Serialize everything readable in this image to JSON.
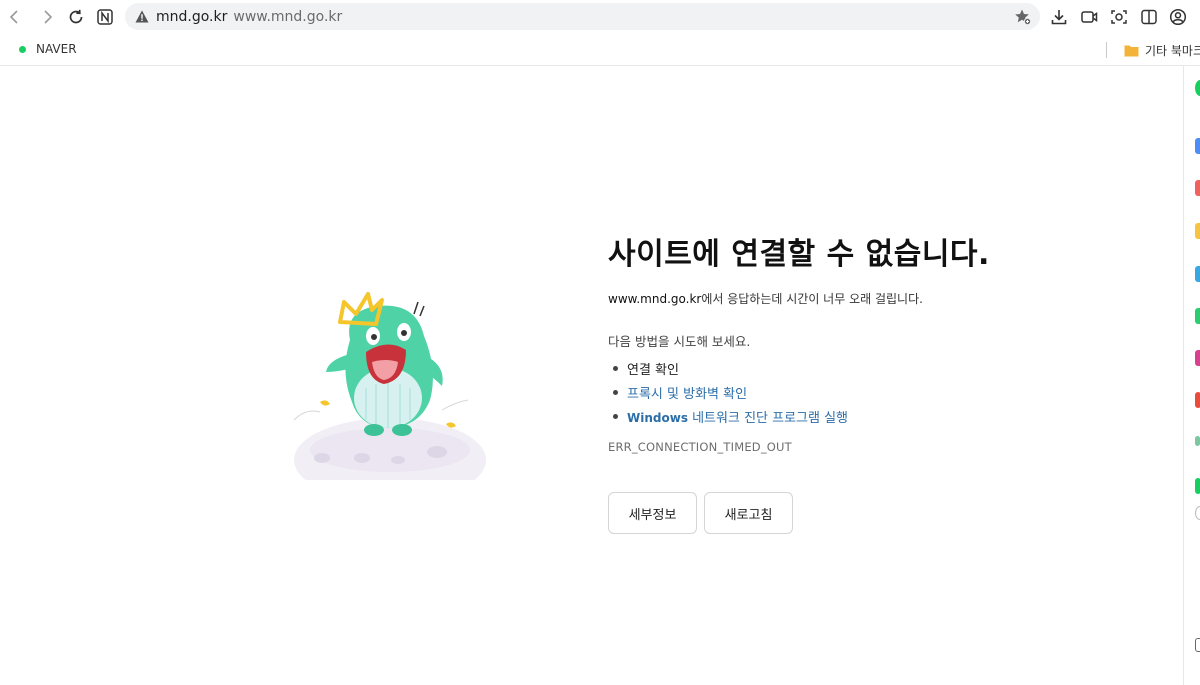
{
  "toolbar": {
    "address_domain": "mnd.go.kr",
    "address_url": "www.mnd.go.kr"
  },
  "bookmarks": {
    "items": [
      {
        "label": "NAVER",
        "icon": "naver-dot-icon",
        "color": "#19ce60"
      }
    ],
    "other_label": "기타 북마크"
  },
  "error_page": {
    "title": "사이트에 연결할 수 없습니다.",
    "description_host": "www.mnd.go.kr",
    "description_rest": "에서 응답하는데 시간이 너무 오래 걸립니다.",
    "try_text": "다음 방법을 시도해 보세요.",
    "suggestions": [
      {
        "text": "연결 확인"
      },
      {
        "text": "프록시 및 방화벽 확인"
      },
      {
        "prefix": "Windows",
        "text": " 네트워크 진단 프로그램 실행"
      }
    ],
    "error_code": "ERR_CONNECTION_TIMED_OUT",
    "buttons": {
      "details": "세부정보",
      "reload": "새로고침"
    }
  },
  "colors": {
    "link": "#2b6ea8",
    "mascot": "#4fd3a6",
    "crown": "#f5c52c"
  }
}
